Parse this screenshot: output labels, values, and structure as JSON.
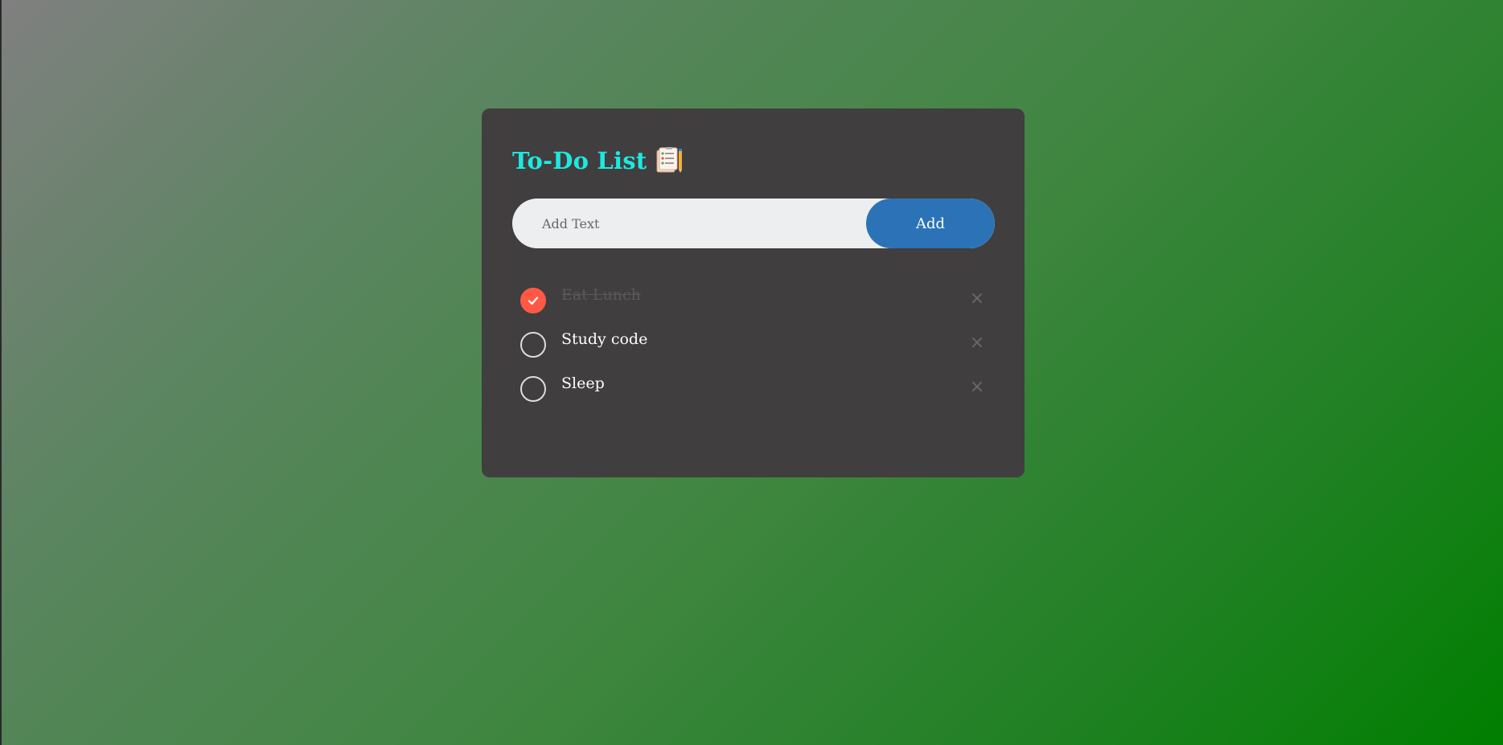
{
  "app": {
    "title": "To-Do List",
    "title_icon": "notepad-icon"
  },
  "colors": {
    "title": "#1ee8e0",
    "card_bg": "#403e3e",
    "add_button": "#2b73b6",
    "checked": "#ff5945"
  },
  "input": {
    "placeholder": "Add Text",
    "value": ""
  },
  "add_button": {
    "label": "Add"
  },
  "tasks": [
    {
      "text": "Eat Lunch",
      "done": true
    },
    {
      "text": "Study code",
      "done": false
    },
    {
      "text": "Sleep",
      "done": false
    }
  ],
  "delete_glyph": "×"
}
